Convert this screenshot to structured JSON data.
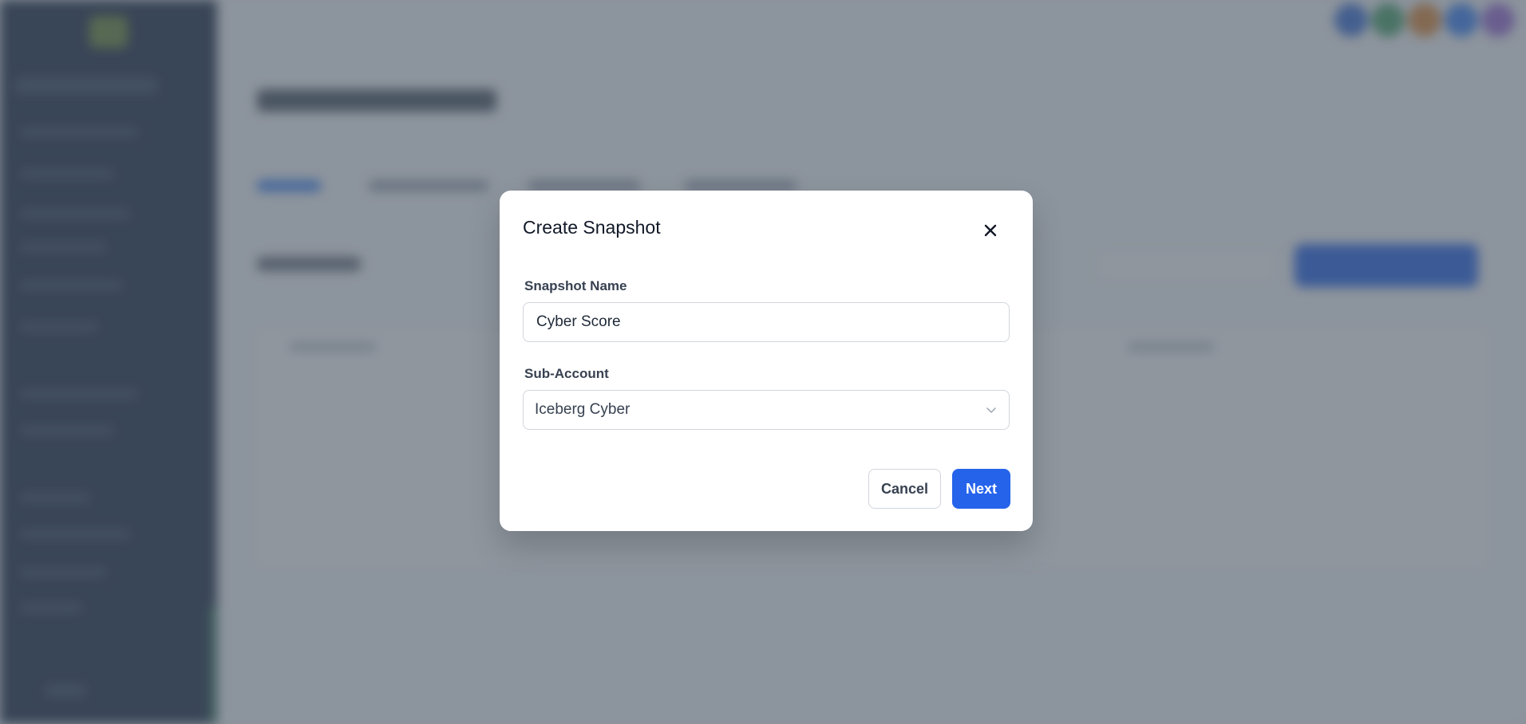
{
  "modal": {
    "title": "Create Snapshot",
    "fields": {
      "snapshot_name_label": "Snapshot Name",
      "snapshot_name_value": "Cyber Score",
      "sub_account_label": "Sub-Account",
      "sub_account_value": "Iceberg Cyber"
    },
    "buttons": {
      "cancel": "Cancel",
      "next": "Next"
    }
  },
  "icons": {
    "close": "close-icon",
    "dropdown": "chevron-down-icon"
  },
  "colors": {
    "primary": "#2563eb",
    "overlay": "rgba(75,85,99,0.62)",
    "sidebar": "#1f2d45"
  }
}
